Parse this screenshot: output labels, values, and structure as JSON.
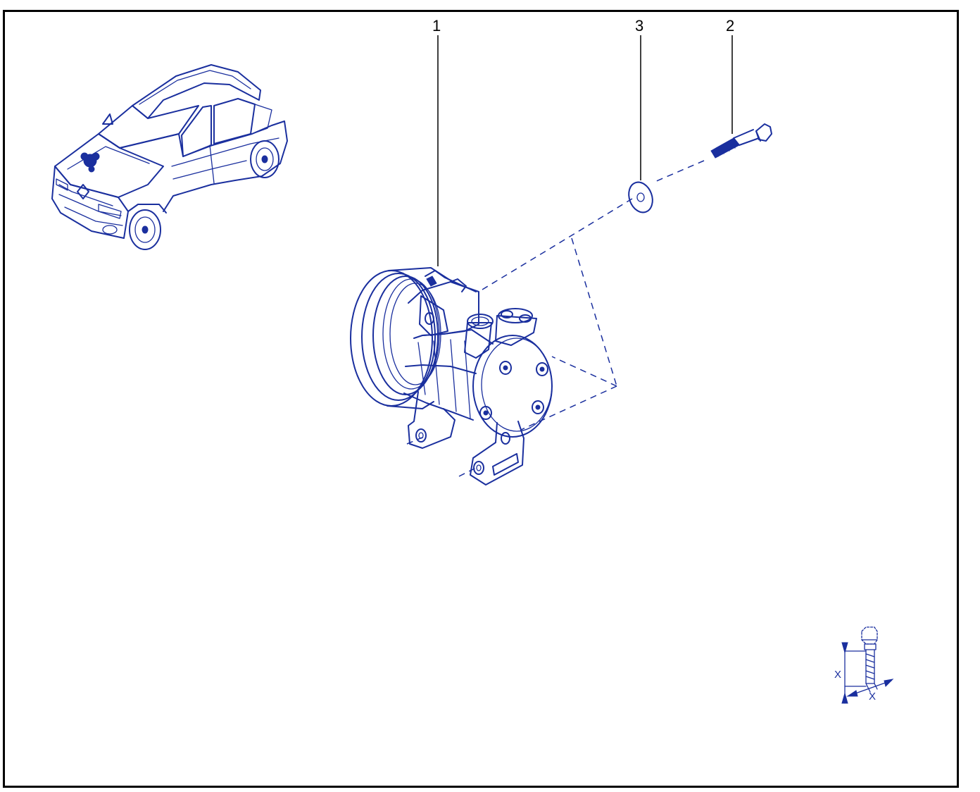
{
  "diagram": {
    "callouts": [
      {
        "id": "1",
        "label": "1"
      },
      {
        "id": "2",
        "label": "2"
      },
      {
        "id": "3",
        "label": "3"
      }
    ],
    "icon": {
      "x_label_left": "X",
      "x_label_right": "X"
    }
  },
  "colors": {
    "line": "#1a2f9e",
    "callout": "#000000",
    "frame": "#000000",
    "background": "#ffffff"
  }
}
